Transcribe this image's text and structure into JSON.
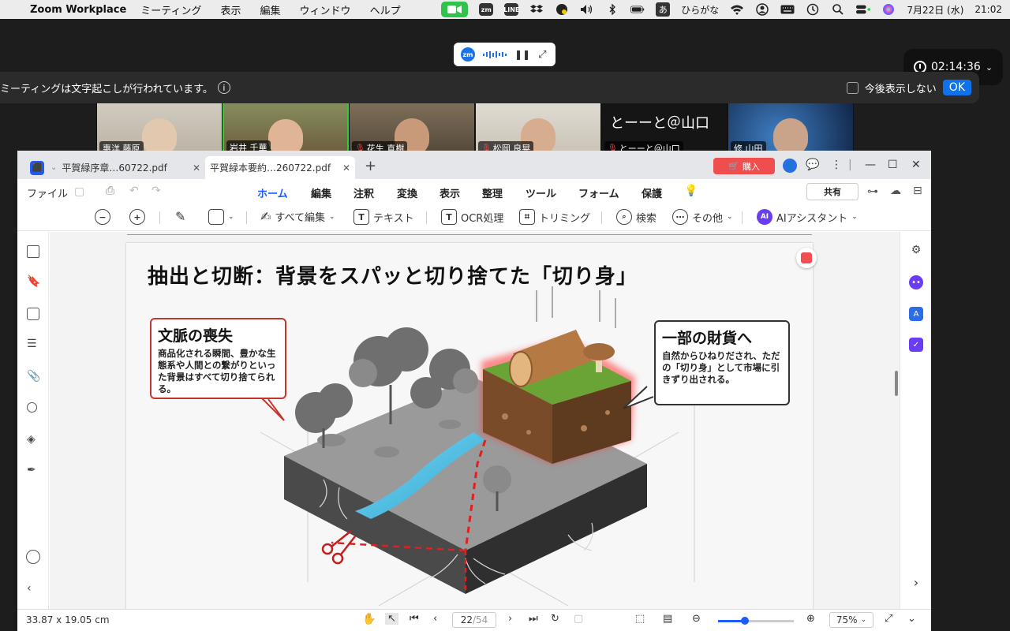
{
  "menubar": {
    "app_name": "Zoom Workplace",
    "items": [
      "ミーティング",
      "表示",
      "編集",
      "ウィンドウ",
      "ヘルプ"
    ],
    "ime_label": "あ",
    "ime_mode": "ひらがな",
    "date": "7月22日 (水)",
    "time": "21:02",
    "zm_label": "zm",
    "line_label": "LINE"
  },
  "zoom": {
    "mini_logo": "zm",
    "timer": "02:14:36",
    "caption_text": "ミーティングは文字起こしが行われています。",
    "dont_show_label": "今後表示しない",
    "ok_label": "OK",
    "participants": [
      {
        "name": "惠洋 藤原",
        "muted": false,
        "active": false,
        "bg": "#c9c2b6"
      },
      {
        "name": "岩井 千華",
        "muted": false,
        "active": true,
        "bg": "#6f7c3f"
      },
      {
        "name": "花生 直樹",
        "muted": true,
        "active": false,
        "bg": "#6b5d4d"
      },
      {
        "name": "松岡 良晃",
        "muted": true,
        "active": false,
        "bg": "#d9d2c6"
      },
      {
        "name": "とーーと＠山口",
        "muted": true,
        "active": false,
        "bg": "#141414",
        "big_text": "とーーと＠山口"
      },
      {
        "name": "修 山田",
        "muted": false,
        "active": false,
        "bg": "#1e3a66"
      }
    ]
  },
  "pdf": {
    "tabs": [
      {
        "title": "平賀緑序章…60722.pdf"
      },
      {
        "title": "平賀緑本要約…260722.pdf"
      }
    ],
    "buy_label": "購入",
    "file_menu": "ファイル",
    "menu_items": [
      "ホーム",
      "編集",
      "注釈",
      "変換",
      "表示",
      "整理",
      "ツール",
      "フォーム",
      "保護"
    ],
    "share_label": "共有",
    "tools": {
      "edit_all": "すべて編集",
      "text": "テキスト",
      "ocr": "OCR処理",
      "trim": "トリミング",
      "search": "検索",
      "more": "その他",
      "ai": "AIアシスタント"
    },
    "slide": {
      "title": "抽出と切断：背景をスパッと切り捨てた「切り身」",
      "left_heading": "文脈の喪失",
      "left_body": "商品化される瞬間、豊かな生態系や人間との繋がりといった背景はすべて切り捨てられる。",
      "right_heading": "一部の財貨へ",
      "right_body": "自然からひねりだされ、ただの「切り身」として市場に引きずり出される。"
    },
    "status": {
      "dimensions": "33.87 x 19.05 cm",
      "page_current": "22",
      "page_total": "/54",
      "zoom": "75%",
      "zoom_level": 0.35
    }
  }
}
